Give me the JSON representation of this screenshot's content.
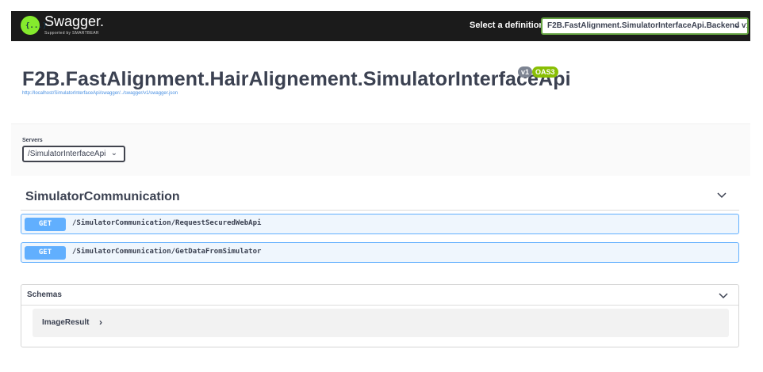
{
  "topbar": {
    "brand": "Swagger.",
    "brand_sub": "Supported by SMARTBEAR",
    "logo_glyph": "{...}",
    "definition_label": "Select a definition",
    "definition_value": "F2B.FastAlignment.SimulatorInterfaceApi.Backend v1"
  },
  "info": {
    "title": "F2B.FastAlignment.HairAlignement.SimulatorInterfaceApi",
    "version_badge": "v1",
    "oas_badge": "OAS3",
    "url": "http://localhost/SimulatorInterfaceApi/swagger/../swagger/v1/swagger.json"
  },
  "servers": {
    "label": "Servers",
    "selected": "/SimulatorInterfaceApi"
  },
  "tag": {
    "name": "SimulatorCommunication",
    "operations": [
      {
        "method": "GET",
        "path": "/SimulatorCommunication/RequestSecuredWebApi"
      },
      {
        "method": "GET",
        "path": "/SimulatorCommunication/GetDataFromSimulator"
      }
    ]
  },
  "schemas": {
    "title": "Schemas",
    "models": [
      {
        "name": "ImageResult"
      }
    ]
  },
  "colors": {
    "topbar_bg": "#1b1b1b",
    "accent_green": "#85ea2d",
    "get_blue": "#61affe",
    "get_bg": "#eff6fd",
    "oas_green": "#89bf04",
    "version_gray": "#7d8492"
  },
  "icons": {
    "definition_chevron": "chevron-down-icon",
    "servers_chevron": "chevron-down-icon",
    "tag_chevron": "chevron-down-icon",
    "schemas_chevron": "chevron-down-icon",
    "model_expand": "chevron-right-icon"
  }
}
